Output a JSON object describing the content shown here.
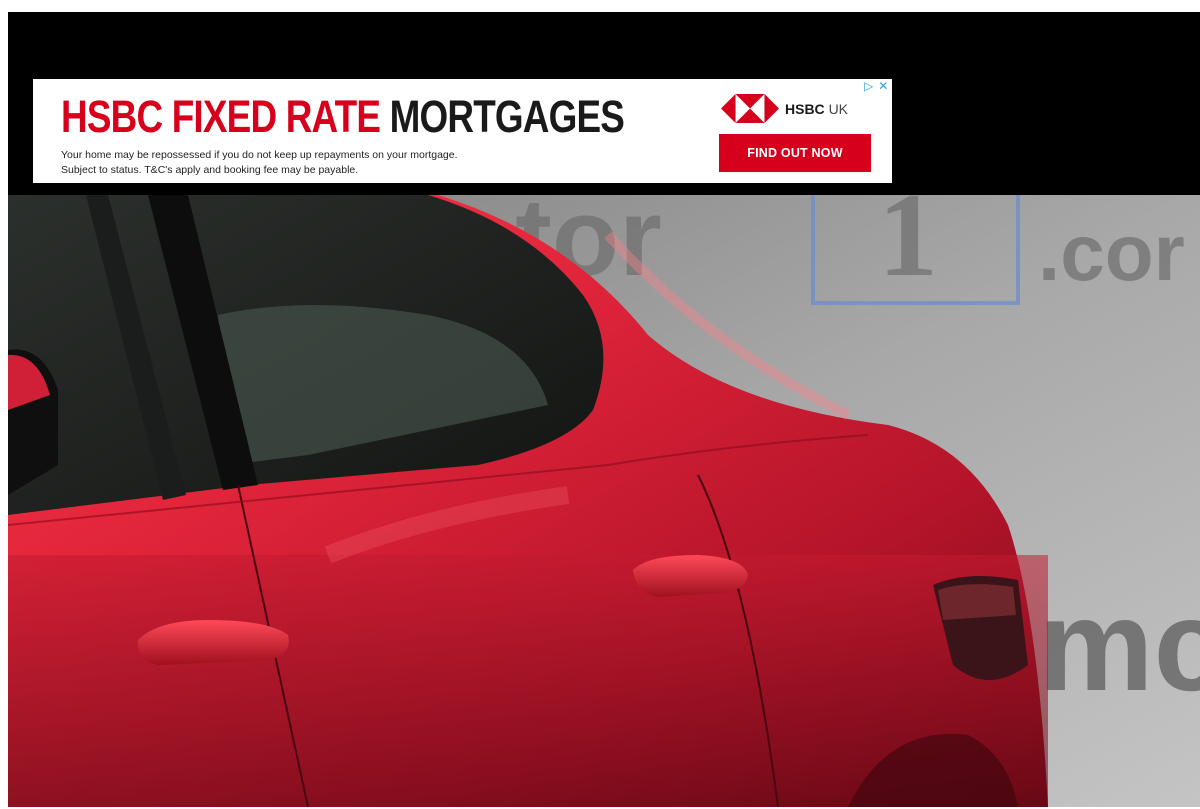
{
  "ad": {
    "headline_red": "HSBC FIXED RATE",
    "headline_dark": "MORTGAGES",
    "disclaimer_line1": "Your home may be repossessed if you do not keep up repayments on your mortgage.",
    "disclaimer_line2": "Subject to status. T&C's apply and booking fee may be payable.",
    "brand": "HSBC",
    "brand_region": "UK",
    "cta_label": "FIND OUT NOW",
    "adchoices_icon": "play-triangle-icon",
    "close_icon": "close-x-icon",
    "colors": {
      "brand_red": "#d6001c",
      "adchoices_blue": "#29a3e0"
    }
  },
  "photo": {
    "subject": "red car rear quarter",
    "watermark_parts": [
      "otor",
      "1",
      ".cor",
      "mc"
    ],
    "colors": {
      "background_grey": "#a9a9a9",
      "car_red": "#d01c2c",
      "glass": "#1f2421"
    }
  }
}
